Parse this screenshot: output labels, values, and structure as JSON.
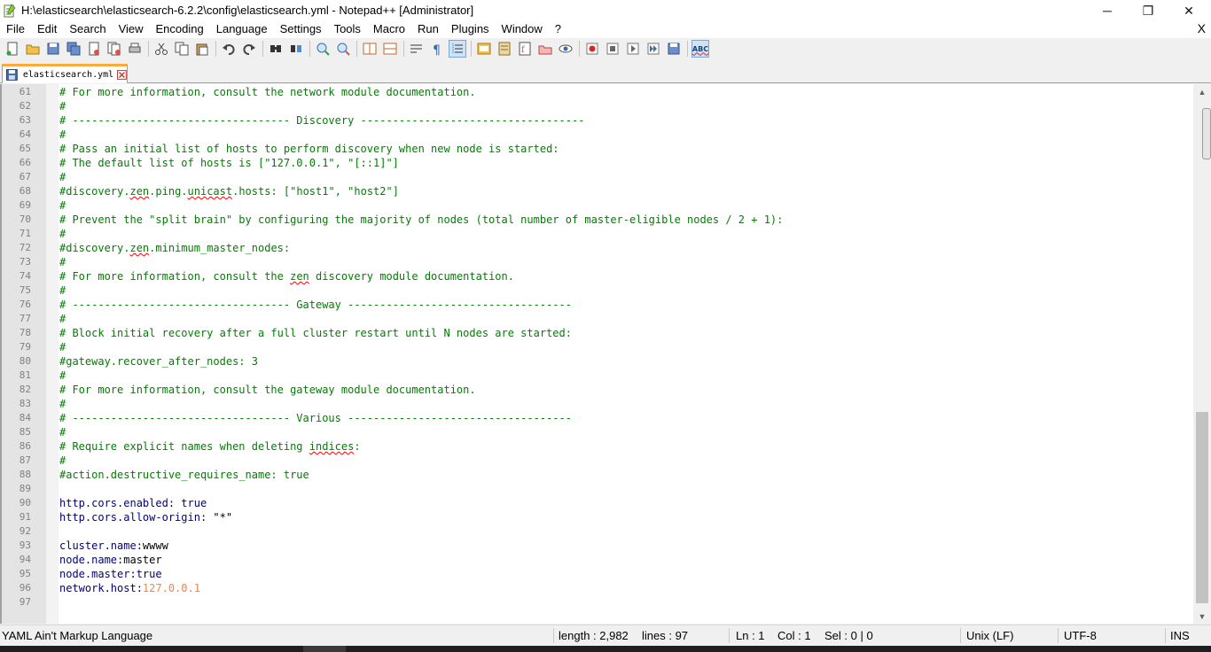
{
  "window": {
    "title": "H:\\elasticsearch\\elasticsearch-6.2.2\\config\\elasticsearch.yml - Notepad++ [Administrator]",
    "minimize_glyph": "─",
    "maximize_glyph": "❐",
    "close_glyph": "✕"
  },
  "menu": {
    "items": [
      "File",
      "Edit",
      "Search",
      "View",
      "Encoding",
      "Language",
      "Settings",
      "Tools",
      "Macro",
      "Run",
      "Plugins",
      "Window",
      "?"
    ],
    "close_glyph": "X"
  },
  "toolbar": {
    "icons": [
      "new-file-icon",
      "open-file-icon",
      "save-icon",
      "save-all-icon",
      "close-icon",
      "close-all-icon",
      "print-icon",
      "cut-icon",
      "copy-icon",
      "paste-icon",
      "undo-icon",
      "redo-icon",
      "find-icon",
      "replace-icon",
      "zoom-in-icon",
      "zoom-out-icon",
      "sync-vertical-icon",
      "sync-horizontal-icon",
      "word-wrap-icon",
      "show-all-chars-icon",
      "indent-guide-icon",
      "user-defined-language-icon",
      "document-map-icon",
      "function-list-icon",
      "folder-as-workspace-icon",
      "monitoring-icon",
      "record-macro-icon",
      "stop-macro-icon",
      "play-macro-icon",
      "run-macro-multiple-icon",
      "save-macro-icon",
      "spell-check-icon"
    ],
    "spell_check_label": "ABC"
  },
  "tabs": [
    {
      "label": "elasticsearch.yml",
      "active": true
    }
  ],
  "editor": {
    "lines": [
      {
        "n": "61",
        "segments": [
          {
            "t": "# For more information, consult the network module documentation.",
            "c": "comment"
          }
        ]
      },
      {
        "n": "62",
        "segments": [
          {
            "t": "#",
            "c": "comment"
          }
        ]
      },
      {
        "n": "63",
        "segments": [
          {
            "t": "# ---------------------------------- Discovery -----------------------------------",
            "c": "comment"
          }
        ]
      },
      {
        "n": "64",
        "segments": [
          {
            "t": "#",
            "c": "comment"
          }
        ]
      },
      {
        "n": "65",
        "segments": [
          {
            "t": "# Pass an initial list of hosts to perform discovery when new node is started:",
            "c": "comment"
          }
        ]
      },
      {
        "n": "66",
        "segments": [
          {
            "t": "# The default list of hosts is [\"127.0.0.1\", \"[::1]\"]",
            "c": "comment"
          }
        ]
      },
      {
        "n": "67",
        "segments": [
          {
            "t": "#",
            "c": "comment"
          }
        ]
      },
      {
        "n": "68",
        "segments": [
          {
            "t": "#discovery.",
            "c": "comment"
          },
          {
            "t": "zen",
            "c": "comment",
            "s": true
          },
          {
            "t": ".ping.",
            "c": "comment"
          },
          {
            "t": "unicast",
            "c": "comment",
            "s": true
          },
          {
            "t": ".hosts: [\"host1\", \"host2\"]",
            "c": "comment"
          }
        ]
      },
      {
        "n": "69",
        "segments": [
          {
            "t": "#",
            "c": "comment"
          }
        ]
      },
      {
        "n": "70",
        "segments": [
          {
            "t": "# Prevent the \"split brain\" by configuring the majority of nodes (total number of master-eligible nodes / 2 + 1):",
            "c": "comment"
          }
        ]
      },
      {
        "n": "71",
        "segments": [
          {
            "t": "#",
            "c": "comment"
          }
        ]
      },
      {
        "n": "72",
        "segments": [
          {
            "t": "#discovery.",
            "c": "comment"
          },
          {
            "t": "zen",
            "c": "comment",
            "s": true
          },
          {
            "t": ".minimum_master_nodes:",
            "c": "comment"
          }
        ]
      },
      {
        "n": "73",
        "segments": [
          {
            "t": "#",
            "c": "comment"
          }
        ]
      },
      {
        "n": "74",
        "segments": [
          {
            "t": "# For more information, consult the ",
            "c": "comment"
          },
          {
            "t": "zen",
            "c": "comment",
            "s": true
          },
          {
            "t": " discovery module documentation.",
            "c": "comment"
          }
        ]
      },
      {
        "n": "75",
        "segments": [
          {
            "t": "#",
            "c": "comment"
          }
        ]
      },
      {
        "n": "76",
        "segments": [
          {
            "t": "# ---------------------------------- Gateway -----------------------------------",
            "c": "comment"
          }
        ]
      },
      {
        "n": "77",
        "segments": [
          {
            "t": "#",
            "c": "comment"
          }
        ]
      },
      {
        "n": "78",
        "segments": [
          {
            "t": "# Block initial recovery after a full cluster restart until N nodes are started:",
            "c": "comment"
          }
        ]
      },
      {
        "n": "79",
        "segments": [
          {
            "t": "#",
            "c": "comment"
          }
        ]
      },
      {
        "n": "80",
        "segments": [
          {
            "t": "#gateway.recover_after_nodes: 3",
            "c": "comment"
          }
        ]
      },
      {
        "n": "81",
        "segments": [
          {
            "t": "#",
            "c": "comment"
          }
        ]
      },
      {
        "n": "82",
        "segments": [
          {
            "t": "# For more information, consult the gateway module documentation.",
            "c": "comment"
          }
        ]
      },
      {
        "n": "83",
        "segments": [
          {
            "t": "#",
            "c": "comment"
          }
        ]
      },
      {
        "n": "84",
        "segments": [
          {
            "t": "# ---------------------------------- Various -----------------------------------",
            "c": "comment"
          }
        ]
      },
      {
        "n": "85",
        "segments": [
          {
            "t": "#",
            "c": "comment"
          }
        ]
      },
      {
        "n": "86",
        "segments": [
          {
            "t": "# Require explicit names when deleting ",
            "c": "comment"
          },
          {
            "t": "indices",
            "c": "comment",
            "s": true
          },
          {
            "t": ":",
            "c": "comment"
          }
        ]
      },
      {
        "n": "87",
        "segments": [
          {
            "t": "#",
            "c": "comment"
          }
        ]
      },
      {
        "n": "88",
        "segments": [
          {
            "t": "#action.destructive_requires_name: true",
            "c": "comment"
          }
        ]
      },
      {
        "n": "89",
        "segments": []
      },
      {
        "n": "90",
        "segments": [
          {
            "t": "http.cors.enabled: ",
            "c": "key"
          },
          {
            "t": "true",
            "c": "val"
          }
        ]
      },
      {
        "n": "91",
        "segments": [
          {
            "t": "http.cors.allow-origin: ",
            "c": "key"
          },
          {
            "t": "\"*\"",
            "c": "plain"
          }
        ]
      },
      {
        "n": "92",
        "segments": []
      },
      {
        "n": "93",
        "segments": [
          {
            "t": "cluster.name:",
            "c": "key"
          },
          {
            "t": "wwww",
            "c": "plain"
          }
        ]
      },
      {
        "n": "94",
        "segments": [
          {
            "t": "node.name:",
            "c": "key"
          },
          {
            "t": "master",
            "c": "plain"
          }
        ]
      },
      {
        "n": "95",
        "segments": [
          {
            "t": "node.master:",
            "c": "key"
          },
          {
            "t": "true",
            "c": "val"
          }
        ]
      },
      {
        "n": "96",
        "segments": [
          {
            "t": "network.host:",
            "c": "key"
          },
          {
            "t": "127.0.0.1",
            "c": "num"
          }
        ]
      },
      {
        "n": "97",
        "segments": []
      }
    ]
  },
  "colors": {
    "comment": "#008000",
    "key": "#000080",
    "number": "#ff8040",
    "active_tab_accent": "#fbab3d"
  },
  "status": {
    "language": "YAML Ain't Markup Language",
    "length": "length : 2,982",
    "lines": "lines : 97",
    "ln": "Ln : 1",
    "col": "Col : 1",
    "sel": "Sel : 0 | 0",
    "eol": "Unix (LF)",
    "encoding": "UTF-8",
    "mode": "INS"
  }
}
